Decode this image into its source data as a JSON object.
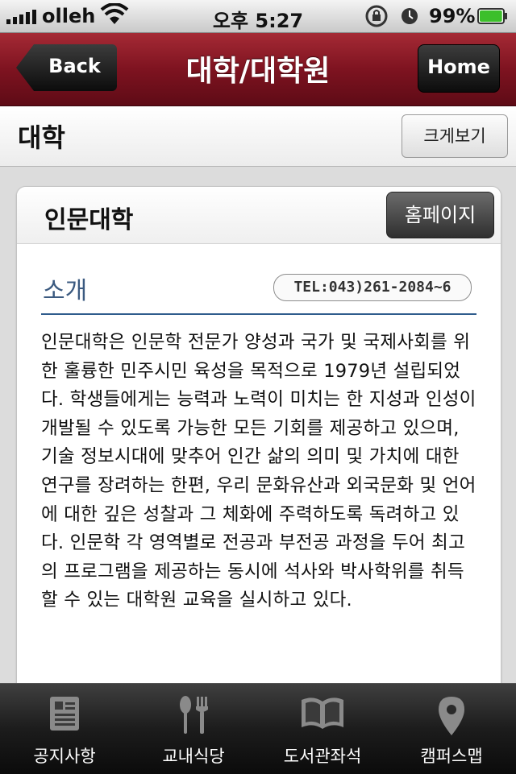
{
  "status_bar": {
    "carrier": "olleh",
    "time": "오후 5:27",
    "battery_percent": "99%",
    "battery_level": 0.99,
    "signal_bars": 5
  },
  "nav": {
    "back_label": "Back",
    "title": "대학/대학원",
    "home_label": "Home"
  },
  "section": {
    "title": "대학",
    "view_large_label": "크게보기"
  },
  "card": {
    "title": "인문대학",
    "homepage_label": "홈페이지",
    "intro_label": "소개",
    "tel": "TEL:043)261-2084~6",
    "description": "인문대학은 인문학 전문가 양성과 국가 및 국제사회를 위한 훌륭한 민주시민 육성을 목적으로 1979년 설립되었다. 학생들에게는 능력과 노력이 미치는 한 지성과 인성이 개발될 수 있도록 가능한 모든 기회를 제공하고 있으며, 기술 정보시대에 맞추어 인간 삶의 의미 및 가치에 대한 연구를 장려하는 한편, 우리 문화유산과 외국문화 및 언어에 대한 깊은 성찰과 그 체화에 주력하도록 독려하고 있다. 인문학 각 영역별로 전공과 부전공 과정을 두어 최고의 프로그램을 제공하는 동시에 석사와 박사학위를 취득할 수 있는 대학원 교육을 실시하고 있다."
  },
  "tabs": [
    {
      "label": "공지사항",
      "icon": "notice-icon"
    },
    {
      "label": "교내식당",
      "icon": "fork-spoon-icon"
    },
    {
      "label": "도서관좌석",
      "icon": "book-icon"
    },
    {
      "label": "캠퍼스맵",
      "icon": "map-pin-icon"
    }
  ],
  "colors": {
    "navbar": "#7e1320",
    "accent_blue": "#2f5c8c",
    "tabbar": "#1c1c1c"
  }
}
